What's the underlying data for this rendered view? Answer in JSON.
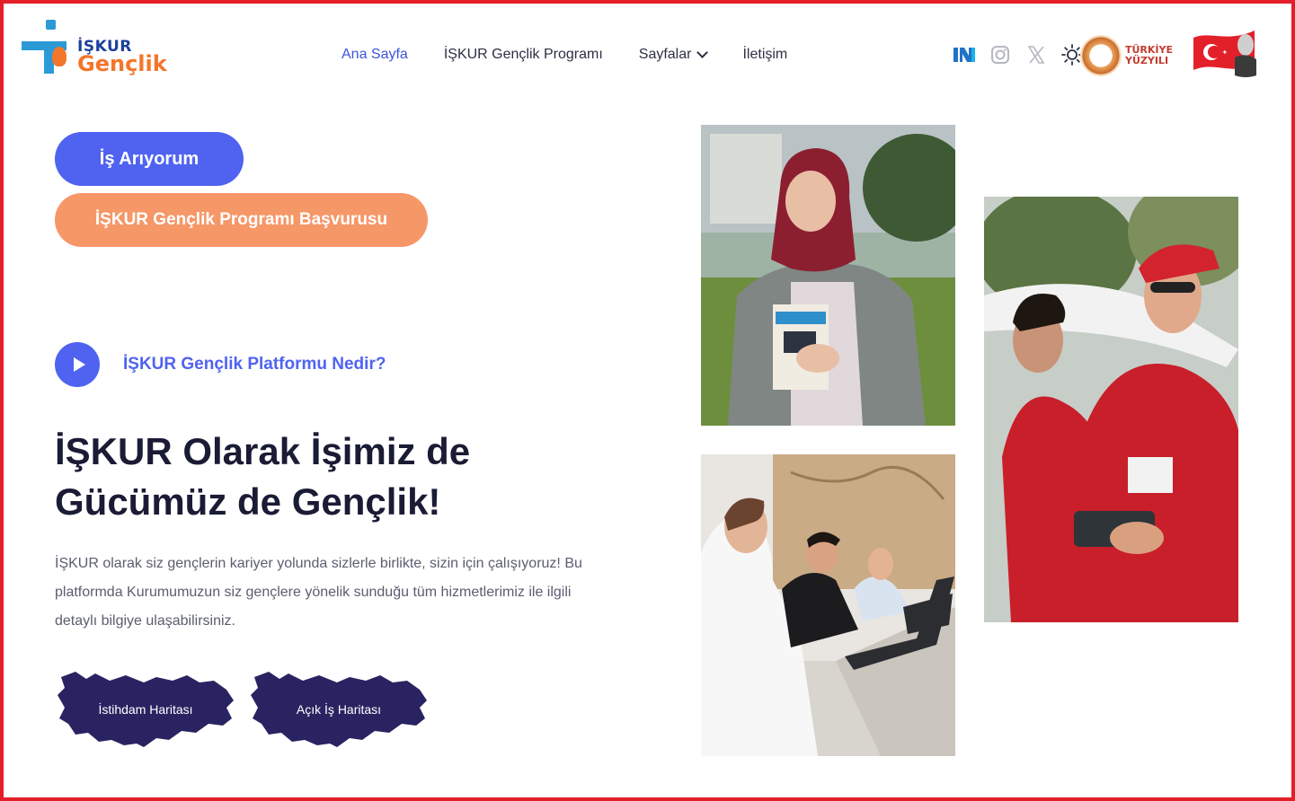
{
  "brand": {
    "logo_line1": "İŞKUR",
    "logo_line2": "Gençlik"
  },
  "nav": {
    "items": [
      {
        "label": "Ana Sayfa",
        "active": true
      },
      {
        "label": "İŞKUR Gençlik Programı",
        "active": false
      },
      {
        "label": "Sayfalar",
        "active": false,
        "dropdown": true
      },
      {
        "label": "İletişim",
        "active": false
      }
    ]
  },
  "header_icons": [
    "nsosyal-icon",
    "instagram-icon",
    "x-icon",
    "sun-icon"
  ],
  "badge": {
    "line1": "TÜRKİYE",
    "line2": "YÜZYILI"
  },
  "hero": {
    "primary_button": "İş Arıyorum",
    "secondary_button": "İŞKUR Gençlik Programı Başvurusu",
    "video_label": "İŞKUR Gençlik Platformu Nedir?",
    "title_line1": "İŞKUR Olarak İşimiz de",
    "title_line2": "Gücümüz de Gençlik!",
    "description": "İŞKUR olarak siz gençlerin kariyer yolunda sizlerle birlikte, sizin için çalışıyoruz! Bu platformda Kurumumuzun siz gençlere yönelik sunduğu tüm hizmetlerimiz ile ilgili detaylı bilgiye ulaşabilirsiniz."
  },
  "map_buttons": [
    {
      "label": "İstihdam Haritası"
    },
    {
      "label": "Açık İş Haritası"
    }
  ],
  "colors": {
    "primary": "#4f63f0",
    "secondary": "#f69768",
    "map": "#2a2361",
    "frame": "#e3202a"
  }
}
